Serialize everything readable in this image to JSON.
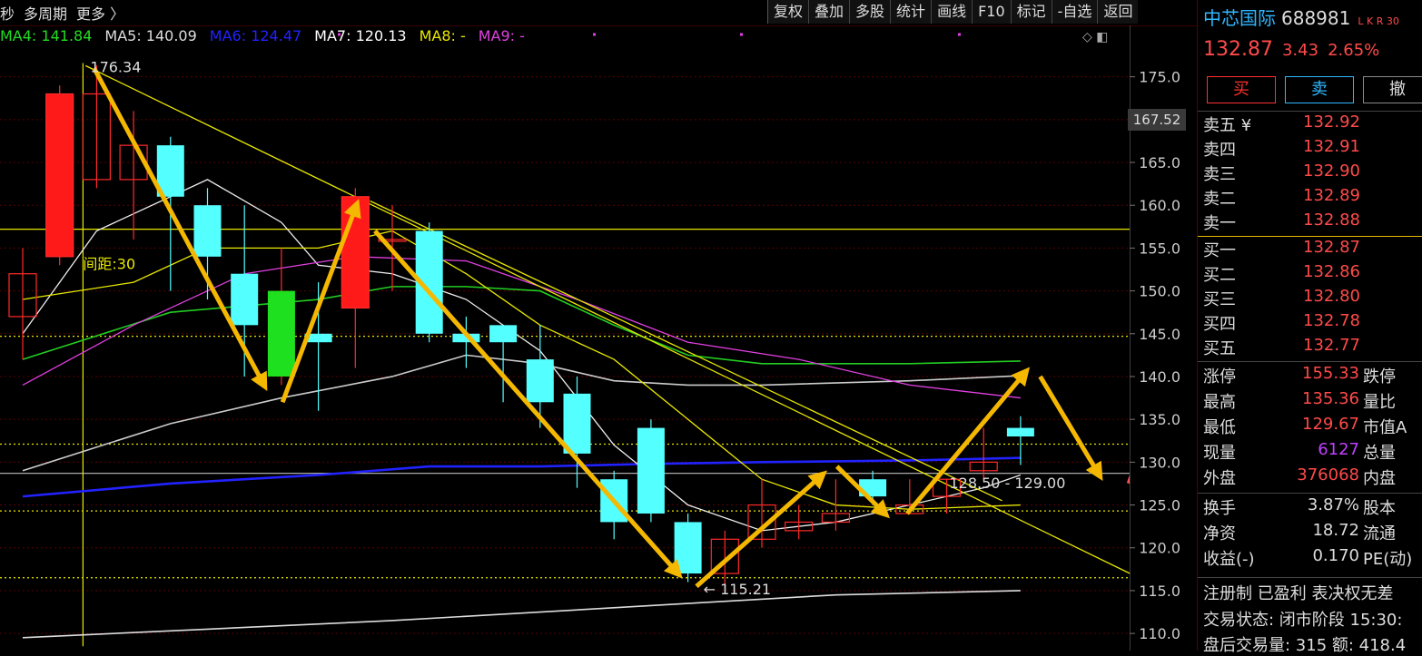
{
  "toolbar": {
    "left_items": [
      "秒",
      "多周期",
      "更多 〉"
    ],
    "buttons": [
      "复权",
      "叠加",
      "多股",
      "统计",
      "画线",
      "F10",
      "标记",
      "-自选",
      "返回"
    ]
  },
  "legend": [
    {
      "label": "MA4: 141.84",
      "color": "#22dd22"
    },
    {
      "label": "MA5: 140.09",
      "color": "#dddddd"
    },
    {
      "label": "MA6: 124.47",
      "color": "#2222ff"
    },
    {
      "label": "MA7: 120.13",
      "color": "#ffffff"
    },
    {
      "label": "MA8: -",
      "color": "#e8e800"
    },
    {
      "label": "MA9: -",
      "color": "#e040e0"
    }
  ],
  "legend_tools": "◇ ◧",
  "chart_data": {
    "type": "candlestick",
    "ylim": [
      108,
      181
    ],
    "yticks": [
      110,
      115,
      120,
      125,
      130,
      135,
      140,
      145,
      150,
      155,
      160,
      165,
      170,
      175
    ],
    "last_price_label": "167.52",
    "candles": [
      {
        "o": 147,
        "c": 152,
        "h": 155,
        "l": 142
      },
      {
        "o": 154,
        "c": 173,
        "h": 174,
        "l": 153
      },
      {
        "o": 163,
        "c": 173,
        "h": 176.34,
        "l": 162
      },
      {
        "o": 163,
        "c": 167,
        "h": 171,
        "l": 156
      },
      {
        "o": 167,
        "c": 161,
        "h": 168,
        "l": 150
      },
      {
        "o": 160,
        "c": 154,
        "h": 162,
        "l": 149
      },
      {
        "o": 152,
        "c": 146,
        "h": 160,
        "l": 140
      },
      {
        "o": 140,
        "c": 150,
        "h": 155,
        "l": 139
      },
      {
        "o": 145,
        "c": 144,
        "h": 151,
        "l": 136
      },
      {
        "o": 148,
        "c": 161,
        "h": 162,
        "l": 141
      },
      {
        "o": 156,
        "c": 156,
        "h": 160,
        "l": 150
      },
      {
        "o": 157,
        "c": 145,
        "h": 158,
        "l": 144
      },
      {
        "o": 145,
        "c": 144,
        "h": 147,
        "l": 141
      },
      {
        "o": 146,
        "c": 144,
        "h": 146,
        "l": 137
      },
      {
        "o": 142,
        "c": 137,
        "h": 146,
        "l": 134
      },
      {
        "o": 138,
        "c": 131,
        "h": 140,
        "l": 127
      },
      {
        "o": 128,
        "c": 123,
        "h": 129,
        "l": 121
      },
      {
        "o": 134,
        "c": 124,
        "h": 135,
        "l": 123
      },
      {
        "o": 123,
        "c": 117,
        "h": 124,
        "l": 116
      },
      {
        "o": 117,
        "c": 121,
        "h": 122,
        "l": 115.21
      },
      {
        "o": 121,
        "c": 125,
        "h": 128,
        "l": 120
      },
      {
        "o": 122,
        "c": 123,
        "h": 125,
        "l": 121
      },
      {
        "o": 123,
        "c": 124,
        "h": 128,
        "l": 122
      },
      {
        "o": 128,
        "c": 126,
        "h": 129,
        "l": 125
      },
      {
        "o": 124,
        "c": 125,
        "h": 128,
        "l": 124
      },
      {
        "o": 126,
        "c": 128,
        "h": 128,
        "l": 124
      },
      {
        "o": 129,
        "c": 130,
        "h": 134,
        "l": 128
      },
      {
        "o": 134,
        "c": 133,
        "h": 135.36,
        "l": 129.67
      }
    ],
    "ma_lines": [
      {
        "name": "MA4",
        "color": "#22cc22",
        "points": [
          [
            0,
            142
          ],
          [
            4,
            147.5
          ],
          [
            8,
            149
          ],
          [
            10,
            150.5
          ],
          [
            12,
            150.5
          ],
          [
            14,
            150
          ],
          [
            16,
            146
          ],
          [
            18,
            142.5
          ],
          [
            20,
            141.5
          ],
          [
            24,
            141.5
          ],
          [
            27,
            141.8
          ]
        ]
      },
      {
        "name": "MA5",
        "color": "#cccccc",
        "points": [
          [
            0,
            129
          ],
          [
            4,
            134.5
          ],
          [
            7,
            137.5
          ],
          [
            10,
            140
          ],
          [
            12,
            142.5
          ],
          [
            14,
            141.5
          ],
          [
            16,
            139.5
          ],
          [
            18,
            139
          ],
          [
            20,
            139
          ],
          [
            24,
            139.5
          ],
          [
            27,
            140.1
          ]
        ]
      },
      {
        "name": "MA6",
        "color": "#2222ff",
        "points": [
          [
            0,
            126
          ],
          [
            4,
            127.5
          ],
          [
            8,
            128.5
          ],
          [
            11,
            129.5
          ],
          [
            14,
            129.5
          ],
          [
            17,
            129.8
          ],
          [
            20,
            130
          ],
          [
            24,
            130.2
          ],
          [
            27,
            130.5
          ]
        ]
      },
      {
        "name": "MA7",
        "color": "#dddddd",
        "points": [
          [
            0,
            109.5
          ],
          [
            5,
            110.5
          ],
          [
            10,
            111.5
          ],
          [
            14,
            112.5
          ],
          [
            18,
            113.5
          ],
          [
            22,
            114.5
          ],
          [
            27,
            115
          ]
        ]
      }
    ],
    "short_ma_lines": [
      {
        "color": "#eeeeee",
        "points": [
          [
            0,
            145
          ],
          [
            2,
            157
          ],
          [
            5,
            163
          ],
          [
            7,
            158
          ],
          [
            8,
            153
          ],
          [
            10,
            152
          ],
          [
            12,
            149
          ],
          [
            14,
            143
          ],
          [
            16,
            132
          ],
          [
            18,
            125
          ],
          [
            20,
            122
          ],
          [
            22,
            123
          ],
          [
            24,
            125
          ],
          [
            26,
            127
          ],
          [
            27,
            128.5
          ]
        ]
      },
      {
        "color": "#e8e800",
        "points": [
          [
            0,
            149
          ],
          [
            3,
            151
          ],
          [
            5,
            155
          ],
          [
            8,
            155
          ],
          [
            10,
            157
          ],
          [
            12,
            152
          ],
          [
            14,
            146
          ],
          [
            16,
            142
          ],
          [
            18,
            135
          ],
          [
            20,
            128
          ],
          [
            22,
            125
          ],
          [
            24,
            124.5
          ],
          [
            27,
            125
          ]
        ]
      },
      {
        "color": "#e040e0",
        "points": [
          [
            0,
            139
          ],
          [
            3,
            146
          ],
          [
            6,
            152
          ],
          [
            9,
            154
          ],
          [
            12,
            153.5
          ],
          [
            15,
            149
          ],
          [
            18,
            144
          ],
          [
            21,
            142
          ],
          [
            24,
            139
          ],
          [
            27,
            137.5
          ]
        ]
      }
    ],
    "horizontal_lines": [
      {
        "value": 157.2,
        "color": "#e8e800",
        "style": "solid"
      },
      {
        "value": 144.7,
        "color": "#e8e800",
        "style": "dotted"
      },
      {
        "value": 132.1,
        "color": "#e8e800",
        "style": "dotted"
      },
      {
        "value": 128.7,
        "color": "#aaaaaa",
        "style": "solid"
      },
      {
        "value": 124.3,
        "color": "#e8e800",
        "style": "dotted"
      },
      {
        "value": 116.5,
        "color": "#e8e800",
        "style": "dotted"
      }
    ],
    "annotations": {
      "high_label": "176.34",
      "low_label": "← 115.21",
      "gap_label": "间距:30",
      "range_label": "128.50 - 129.00"
    }
  },
  "stock": {
    "name": "中芯国际",
    "code": "688981",
    "tags": "L K R 30",
    "price": "132.87",
    "change": "3.43",
    "change_pct": "2.65%"
  },
  "trade_buttons": {
    "buy": "买",
    "sell": "卖",
    "cancel": "撤"
  },
  "order_book": {
    "asks": [
      {
        "label": "卖五 ¥",
        "price": "132.92"
      },
      {
        "label": "卖四",
        "price": "132.91"
      },
      {
        "label": "卖三",
        "price": "132.90"
      },
      {
        "label": "卖二",
        "price": "132.89"
      },
      {
        "label": "卖一",
        "price": "132.88"
      }
    ],
    "bids": [
      {
        "label": "买一",
        "price": "132.87"
      },
      {
        "label": "买二",
        "price": "132.86"
      },
      {
        "label": "买三",
        "price": "132.80"
      },
      {
        "label": "买四",
        "price": "132.78"
      },
      {
        "label": "买五",
        "price": "132.77"
      }
    ]
  },
  "stats": [
    {
      "k1": "涨停",
      "v1": "155.33",
      "c1": "red",
      "k2": "跌停"
    },
    {
      "k1": "最高",
      "v1": "135.36",
      "c1": "red",
      "k2": "量比"
    },
    {
      "k1": "最低",
      "v1": "129.67",
      "c1": "red",
      "k2": "市值A"
    },
    {
      "k1": "现量",
      "v1": "6127",
      "c1": "purple",
      "k2": "总量"
    },
    {
      "k1": "外盘",
      "v1": "376068",
      "c1": "red",
      "k2": "内盘"
    },
    {
      "k1": "换手",
      "v1": "3.87%",
      "c1": "white",
      "k2": "股本"
    },
    {
      "k1": "净资",
      "v1": "18.72",
      "c1": "white",
      "k2": "流通"
    },
    {
      "k1": "收益(-)",
      "v1": "0.170",
      "c1": "white",
      "k2": "PE(动)"
    }
  ],
  "info": {
    "line1": "注册制 已盈利 表决权无差",
    "line2": "交易状态: 闭市阶段 15:30:",
    "line3": "盘后交易量: 315  额: 418.4"
  }
}
